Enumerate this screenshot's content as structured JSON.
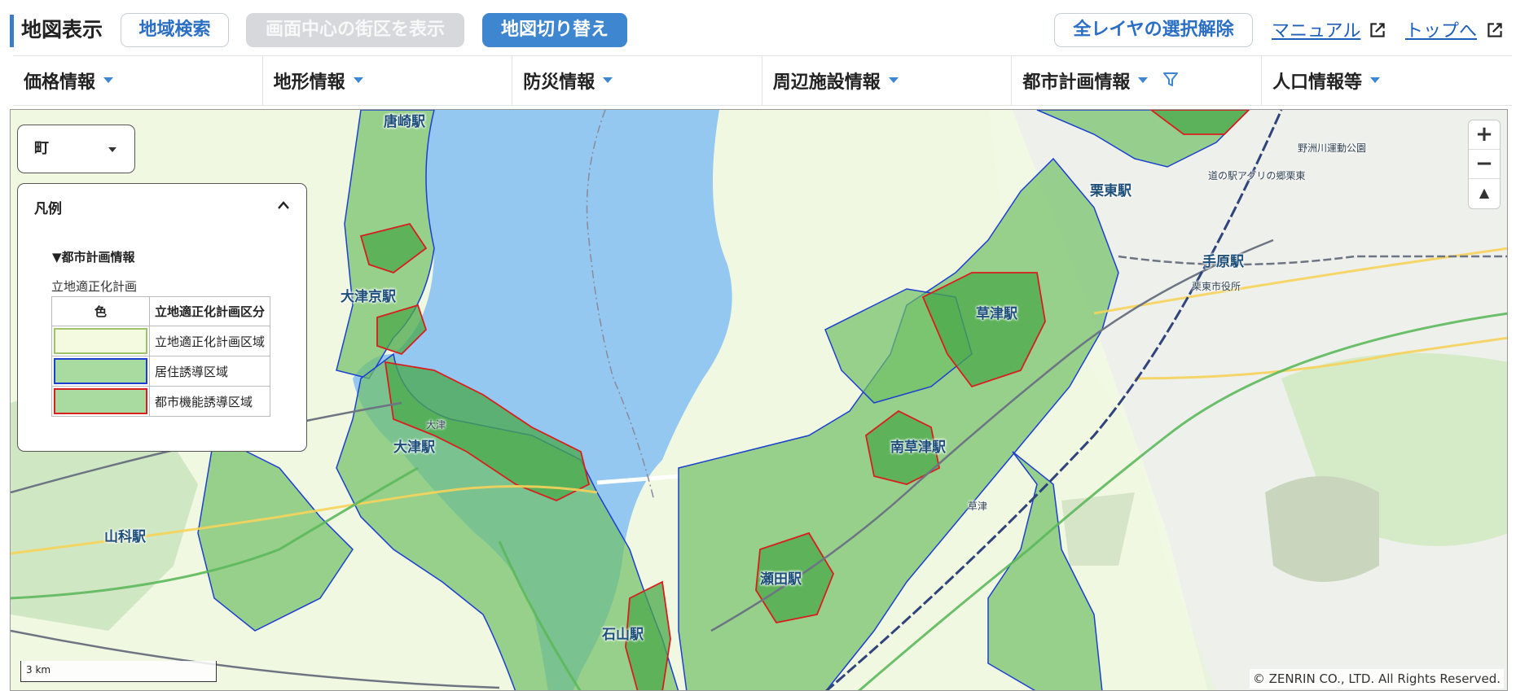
{
  "header": {
    "title": "地図表示",
    "area_search": "地域検索",
    "show_block": "画面中心の街区を表示",
    "switch_map": "地図切り替え",
    "deselect_all": "全レイヤの選択解除",
    "manual": "マニュアル",
    "top": "トップへ"
  },
  "menu": [
    {
      "label": "価格情報"
    },
    {
      "label": "地形情報"
    },
    {
      "label": "防災情報"
    },
    {
      "label": "周辺施設情報"
    },
    {
      "label": "都市計画情報"
    },
    {
      "label": "人口情報等"
    }
  ],
  "map": {
    "town_select": "町",
    "legend": {
      "title": "凡例",
      "section": "▼都市計画情報",
      "subtitle": "立地適正化計画",
      "col_color": "色",
      "col_name": "立地適正化計画区分",
      "rows": [
        {
          "name": "立地適正化計画区域",
          "fill": "#f3fadf",
          "border": "#9fc26a"
        },
        {
          "name": "居住誘導区域",
          "fill": "#a9dba0",
          "border": "#1d3fd0"
        },
        {
          "name": "都市機能誘導区域",
          "fill": "#a9dba0",
          "border": "#d81e1e"
        }
      ]
    },
    "zoom_in": "+",
    "zoom_out": "−",
    "compass": "▲",
    "scale": "3 km",
    "copyright": "© ZENRIN CO., LTD. All Rights Reserved.",
    "places": {
      "karasaki": "唐崎駅",
      "otsukyo": "大津京駅",
      "otsu": "大津駅",
      "yamashina": "山科駅",
      "ishiyama": "石山駅",
      "kusatsu": "草津駅",
      "minamikusatsu": "南草津駅",
      "seta": "瀬田駅",
      "ritto": "栗東駅",
      "tehara": "手原駅",
      "ritto_city": "栗東市役所",
      "michinoeki": "道の駅アグリの郷栗東",
      "yasugawa": "野洲川運動公園",
      "otsu_ic": "大津",
      "kusatsu_pa": "草津"
    }
  },
  "colors": {
    "accent": "#3e86d0",
    "lake": "#94c8f0",
    "zone": "#6fbf65",
    "residential_border": "#1d3fd0",
    "urban_border": "#d81e1e"
  }
}
